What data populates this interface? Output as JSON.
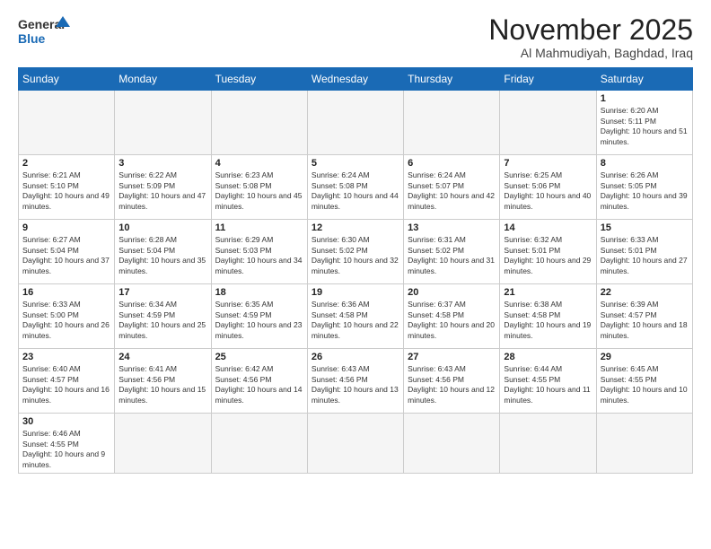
{
  "logo": {
    "line1": "General",
    "line2": "Blue"
  },
  "title": "November 2025",
  "location": "Al Mahmudiyah, Baghdad, Iraq",
  "days_of_week": [
    "Sunday",
    "Monday",
    "Tuesday",
    "Wednesday",
    "Thursday",
    "Friday",
    "Saturday"
  ],
  "weeks": [
    [
      {
        "day": "",
        "info": ""
      },
      {
        "day": "",
        "info": ""
      },
      {
        "day": "",
        "info": ""
      },
      {
        "day": "",
        "info": ""
      },
      {
        "day": "",
        "info": ""
      },
      {
        "day": "",
        "info": ""
      },
      {
        "day": "1",
        "info": "Sunrise: 6:20 AM\nSunset: 5:11 PM\nDaylight: 10 hours and 51 minutes."
      }
    ],
    [
      {
        "day": "2",
        "info": "Sunrise: 6:21 AM\nSunset: 5:10 PM\nDaylight: 10 hours and 49 minutes."
      },
      {
        "day": "3",
        "info": "Sunrise: 6:22 AM\nSunset: 5:09 PM\nDaylight: 10 hours and 47 minutes."
      },
      {
        "day": "4",
        "info": "Sunrise: 6:23 AM\nSunset: 5:08 PM\nDaylight: 10 hours and 45 minutes."
      },
      {
        "day": "5",
        "info": "Sunrise: 6:24 AM\nSunset: 5:08 PM\nDaylight: 10 hours and 44 minutes."
      },
      {
        "day": "6",
        "info": "Sunrise: 6:24 AM\nSunset: 5:07 PM\nDaylight: 10 hours and 42 minutes."
      },
      {
        "day": "7",
        "info": "Sunrise: 6:25 AM\nSunset: 5:06 PM\nDaylight: 10 hours and 40 minutes."
      },
      {
        "day": "8",
        "info": "Sunrise: 6:26 AM\nSunset: 5:05 PM\nDaylight: 10 hours and 39 minutes."
      }
    ],
    [
      {
        "day": "9",
        "info": "Sunrise: 6:27 AM\nSunset: 5:04 PM\nDaylight: 10 hours and 37 minutes."
      },
      {
        "day": "10",
        "info": "Sunrise: 6:28 AM\nSunset: 5:04 PM\nDaylight: 10 hours and 35 minutes."
      },
      {
        "day": "11",
        "info": "Sunrise: 6:29 AM\nSunset: 5:03 PM\nDaylight: 10 hours and 34 minutes."
      },
      {
        "day": "12",
        "info": "Sunrise: 6:30 AM\nSunset: 5:02 PM\nDaylight: 10 hours and 32 minutes."
      },
      {
        "day": "13",
        "info": "Sunrise: 6:31 AM\nSunset: 5:02 PM\nDaylight: 10 hours and 31 minutes."
      },
      {
        "day": "14",
        "info": "Sunrise: 6:32 AM\nSunset: 5:01 PM\nDaylight: 10 hours and 29 minutes."
      },
      {
        "day": "15",
        "info": "Sunrise: 6:33 AM\nSunset: 5:01 PM\nDaylight: 10 hours and 27 minutes."
      }
    ],
    [
      {
        "day": "16",
        "info": "Sunrise: 6:33 AM\nSunset: 5:00 PM\nDaylight: 10 hours and 26 minutes."
      },
      {
        "day": "17",
        "info": "Sunrise: 6:34 AM\nSunset: 4:59 PM\nDaylight: 10 hours and 25 minutes."
      },
      {
        "day": "18",
        "info": "Sunrise: 6:35 AM\nSunset: 4:59 PM\nDaylight: 10 hours and 23 minutes."
      },
      {
        "day": "19",
        "info": "Sunrise: 6:36 AM\nSunset: 4:58 PM\nDaylight: 10 hours and 22 minutes."
      },
      {
        "day": "20",
        "info": "Sunrise: 6:37 AM\nSunset: 4:58 PM\nDaylight: 10 hours and 20 minutes."
      },
      {
        "day": "21",
        "info": "Sunrise: 6:38 AM\nSunset: 4:58 PM\nDaylight: 10 hours and 19 minutes."
      },
      {
        "day": "22",
        "info": "Sunrise: 6:39 AM\nSunset: 4:57 PM\nDaylight: 10 hours and 18 minutes."
      }
    ],
    [
      {
        "day": "23",
        "info": "Sunrise: 6:40 AM\nSunset: 4:57 PM\nDaylight: 10 hours and 16 minutes."
      },
      {
        "day": "24",
        "info": "Sunrise: 6:41 AM\nSunset: 4:56 PM\nDaylight: 10 hours and 15 minutes."
      },
      {
        "day": "25",
        "info": "Sunrise: 6:42 AM\nSunset: 4:56 PM\nDaylight: 10 hours and 14 minutes."
      },
      {
        "day": "26",
        "info": "Sunrise: 6:43 AM\nSunset: 4:56 PM\nDaylight: 10 hours and 13 minutes."
      },
      {
        "day": "27",
        "info": "Sunrise: 6:43 AM\nSunset: 4:56 PM\nDaylight: 10 hours and 12 minutes."
      },
      {
        "day": "28",
        "info": "Sunrise: 6:44 AM\nSunset: 4:55 PM\nDaylight: 10 hours and 11 minutes."
      },
      {
        "day": "29",
        "info": "Sunrise: 6:45 AM\nSunset: 4:55 PM\nDaylight: 10 hours and 10 minutes."
      }
    ],
    [
      {
        "day": "30",
        "info": "Sunrise: 6:46 AM\nSunset: 4:55 PM\nDaylight: 10 hours and 9 minutes."
      },
      {
        "day": "",
        "info": ""
      },
      {
        "day": "",
        "info": ""
      },
      {
        "day": "",
        "info": ""
      },
      {
        "day": "",
        "info": ""
      },
      {
        "day": "",
        "info": ""
      },
      {
        "day": "",
        "info": ""
      }
    ]
  ]
}
